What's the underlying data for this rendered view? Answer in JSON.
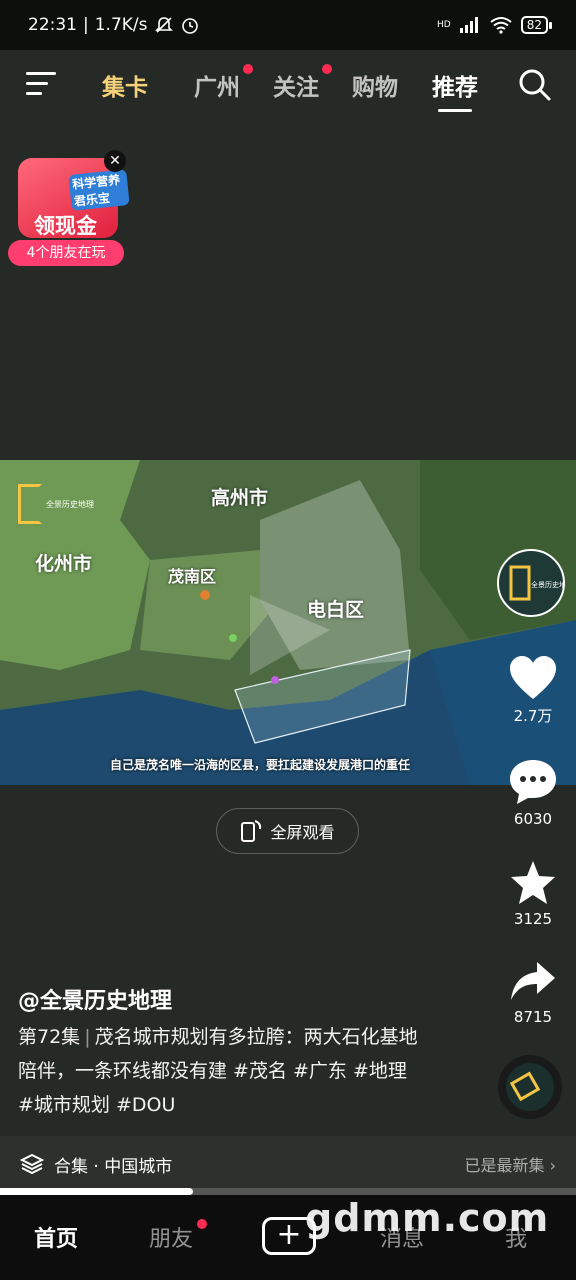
{
  "status_bar": {
    "time": "22:31",
    "speed": "1.7K/s",
    "network": "HD",
    "battery": "82"
  },
  "top_nav": {
    "tabs": [
      {
        "label": "集卡"
      },
      {
        "label": "广州",
        "dot": true
      },
      {
        "label": "关注",
        "dot": true
      },
      {
        "label": "购物"
      },
      {
        "label": "推荐",
        "active": true
      }
    ]
  },
  "promo": {
    "brand": "科学营养 君乐宝",
    "title": "领现金",
    "subtitle": "4个朋友在玩"
  },
  "video": {
    "map_labels": [
      "高州市",
      "化州市",
      "茂南区",
      "电白区"
    ],
    "logo_text": "全景历史地理",
    "subtitle": "自己是茂名唯一沿海的区县，要扛起建设发展港口的重任",
    "fullscreen_label": "全屏观看"
  },
  "side_actions": {
    "likes": "2.7万",
    "comments": "6030",
    "favorites": "3125",
    "shares": "8715"
  },
  "post": {
    "author": "@全景历史地理",
    "episode": "第72集",
    "description": "茂名城市规划有多拉胯：两大石化基地陪伴，一条环线都没有建 #茂名 #广东 #地理 #城市规划 #DOU"
  },
  "collection": {
    "label": "合集 · 中国城市",
    "status": "已是最新集"
  },
  "progress": 0.335,
  "bottom_nav": {
    "items": [
      "首页",
      "朋友",
      "消息",
      "我"
    ]
  },
  "watermark": "gdmm.com",
  "colors": {
    "background": "#262a26",
    "accent_red": "#ff2b55",
    "gold": "#f5d27a"
  }
}
